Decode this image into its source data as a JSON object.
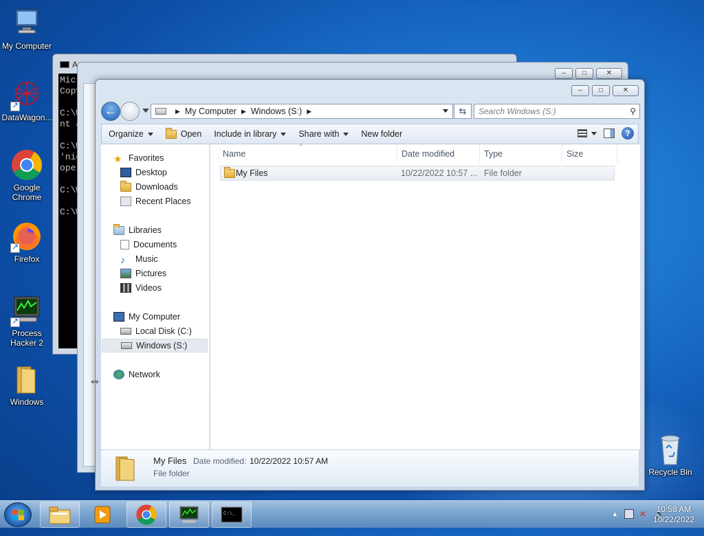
{
  "desktop": {
    "icons": [
      {
        "label": "My Computer",
        "icon": "computer-icon"
      },
      {
        "label": "DataWagon...",
        "icon": "datawagon-icon"
      },
      {
        "label": "Google Chrome",
        "icon": "chrome-icon"
      },
      {
        "label": "Firefox",
        "icon": "firefox-icon"
      },
      {
        "label": "Process Hacker 2",
        "icon": "process-hacker-icon"
      },
      {
        "label": "Windows",
        "icon": "folder-icon"
      },
      {
        "label": "Recycle Bin",
        "icon": "recycle-bin-icon"
      }
    ]
  },
  "cmd_window": {
    "title": "A",
    "lines": [
      "Micr",
      "Copy",
      "",
      "C:\\W",
      "nt a",
      "",
      "C:\\W",
      "'nic",
      "oper",
      "",
      "C:\\W",
      "",
      "C:\\W"
    ]
  },
  "explorer": {
    "caption": {
      "minimize": "–",
      "maximize": "□",
      "close": "✕"
    },
    "breadcrumb": [
      "My Computer",
      "Windows (S:)"
    ],
    "search_placeholder": "Search Windows (S:)",
    "toolbar": {
      "organize": "Organize",
      "open": "Open",
      "include_in_library": "Include in library",
      "share_with": "Share with",
      "new_folder": "New folder"
    },
    "nav": {
      "favorites": "Favorites",
      "desktop": "Desktop",
      "downloads": "Downloads",
      "recent_places": "Recent Places",
      "libraries": "Libraries",
      "documents": "Documents",
      "music": "Music",
      "pictures": "Pictures",
      "videos": "Videos",
      "my_computer": "My Computer",
      "local_disk": "Local Disk (C:)",
      "windows_s": "Windows (S:)",
      "network": "Network"
    },
    "columns": {
      "name": "Name",
      "date_modified": "Date modified",
      "type": "Type",
      "size": "Size"
    },
    "files": [
      {
        "name": "My Files",
        "date_modified": "10/22/2022 10:57 ...",
        "type": "File folder",
        "size": ""
      }
    ],
    "details": {
      "name": "My Files",
      "date_label": "Date modified:",
      "date_value": "10/22/2022 10:57 AM",
      "type": "File folder"
    }
  },
  "taskbar": {
    "clock_time": "10:58 AM",
    "clock_date": "10/22/2022",
    "buttons": [
      "explorer",
      "media-player",
      "chrome",
      "process-hacker",
      "cmd"
    ]
  }
}
